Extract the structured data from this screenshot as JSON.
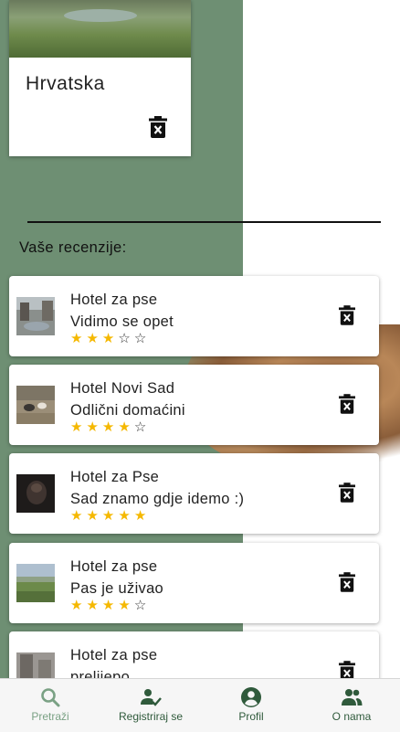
{
  "destination": {
    "name": "Hrvatska"
  },
  "reviews_section": {
    "title": "Vaše recenzije:"
  },
  "reviews": [
    {
      "hotel": "Hotel za pse",
      "comment": "Vidimo se opet",
      "stars": "★★★☆☆",
      "rating": 3
    },
    {
      "hotel": "Hotel Novi Sad",
      "comment": "Odlični domaćini",
      "stars": "★★★★☆",
      "rating": 4
    },
    {
      "hotel": "Hotel za Pse",
      "comment": "Sad znamo gdje idemo :)",
      "stars": "★★★★★",
      "rating": 5
    },
    {
      "hotel": "Hotel za pse",
      "comment": "Pas je uživao",
      "stars": "★★★★☆",
      "rating": 4
    },
    {
      "hotel": "Hotel za pse",
      "comment": "prelijepo",
      "stars": "",
      "rating": null
    }
  ],
  "nav": {
    "items": [
      {
        "label": "Pretraži",
        "icon": "search-icon"
      },
      {
        "label": "Registriraj se",
        "icon": "person-check-icon"
      },
      {
        "label": "Profil",
        "icon": "account-circle-icon"
      },
      {
        "label": "O nama",
        "icon": "group-icon"
      }
    ],
    "active_color": "#2f5a3b",
    "inactive_color": "#7aa184"
  },
  "colors": {
    "background_green": "#6e8f73",
    "star": "#f5b800"
  }
}
